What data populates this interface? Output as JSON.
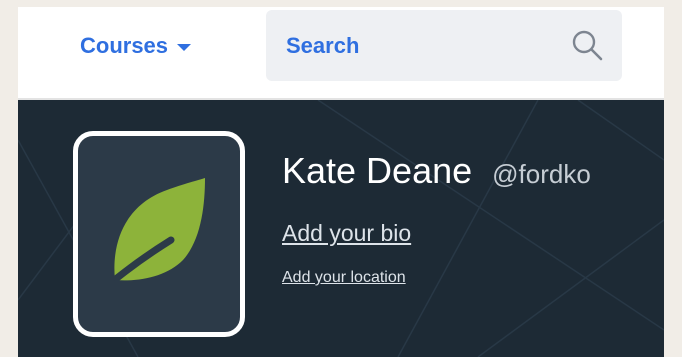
{
  "nav": {
    "courses_label": "Courses",
    "search_placeholder": "Search"
  },
  "profile": {
    "name": "Kate Deane",
    "handle": "@fordko",
    "add_bio_label": "Add your bio",
    "add_location_label": "Add your location",
    "avatar_icon": "leaf-icon"
  },
  "colors": {
    "accent": "#2f6fe0",
    "banner_bg": "#1d2a35",
    "leaf": "#8db33a",
    "page_bg": "#f1ede7"
  }
}
